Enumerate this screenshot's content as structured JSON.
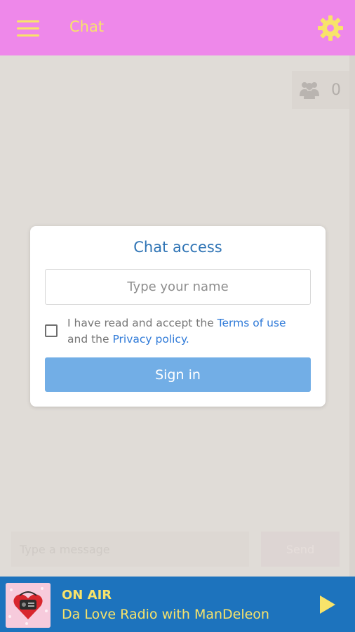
{
  "header": {
    "title": "Chat",
    "menu_icon": "hamburger-menu-icon",
    "settings_icon": "gear-icon",
    "accent_color": "#f8e36a",
    "background_color": "#ee88ea"
  },
  "users": {
    "icon": "users-group-icon",
    "count": "0"
  },
  "dialog": {
    "title": "Chat access",
    "name_placeholder": "Type your name",
    "name_value": "",
    "terms_prefix": "I have read and accept the ",
    "terms_link": "Terms of use",
    "terms_middle": " and the ",
    "privacy_link": "Privacy policy",
    "terms_suffix": ".",
    "sign_in_label": "Sign in",
    "accepted": false
  },
  "composer": {
    "message_placeholder": "Type a message",
    "send_label": "Send"
  },
  "player": {
    "status": "ON AIR",
    "track": "Da Love Radio with ManDeleon",
    "play_icon": "play-icon",
    "cover_icon": "heart-radio-logo-icon"
  }
}
